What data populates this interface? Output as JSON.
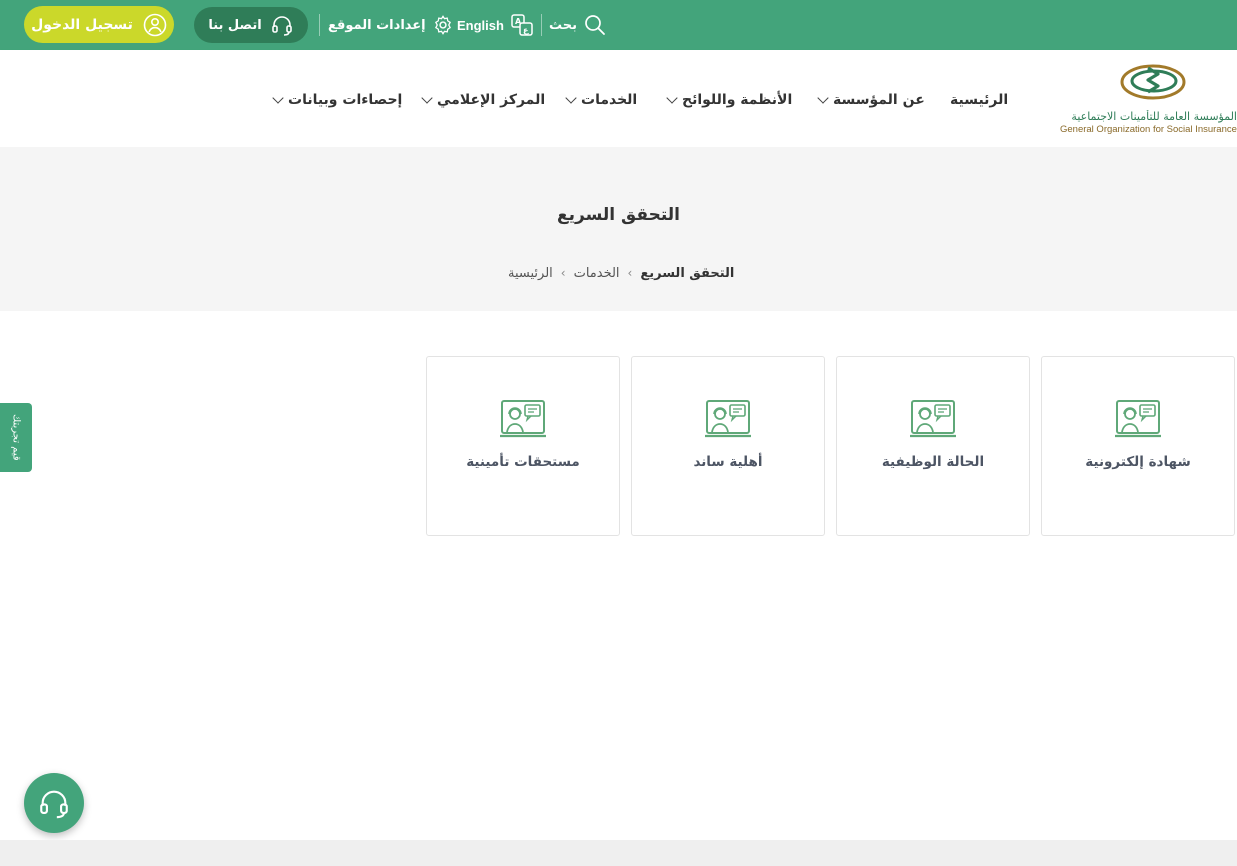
{
  "topbar": {
    "login_label": "تسجيل الدخول",
    "contact_label": "اتصل بنا",
    "settings_label": "إعدادات الموقع",
    "language_label": "English",
    "search_label": "بحث"
  },
  "logo": {
    "name_ar": "المؤسسة العامة للتأمينات الاجتماعية",
    "name_en": "General Organization for Social Insurance"
  },
  "nav": {
    "items": [
      {
        "label": "الرئيسية"
      },
      {
        "label": "عن المؤسسة"
      },
      {
        "label": "الأنظمة واللوائح"
      },
      {
        "label": "الخدمات"
      },
      {
        "label": "المركز الإعلامي"
      },
      {
        "label": "إحصاءات وبيانات"
      }
    ]
  },
  "page": {
    "title": "التحقق السريع",
    "breadcrumb": [
      "الرئيسية",
      "الخدمات",
      "التحقق السريع"
    ]
  },
  "cards": [
    {
      "label": "شهادة إلكترونية",
      "icon": "online-support-icon"
    },
    {
      "label": "الحالة الوظيفية",
      "icon": "online-support-icon"
    },
    {
      "label": "أهلية ساند",
      "icon": "online-support-icon"
    },
    {
      "label": "مستحقات تأمينية",
      "icon": "online-support-icon"
    }
  ],
  "side_tab": {
    "label": "قيم تجربتك"
  },
  "colors": {
    "brand_green": "#43a47b",
    "dark_green": "#2f7d58",
    "login_yellow": "#cbd82a",
    "icon_green": "#5fa878"
  }
}
